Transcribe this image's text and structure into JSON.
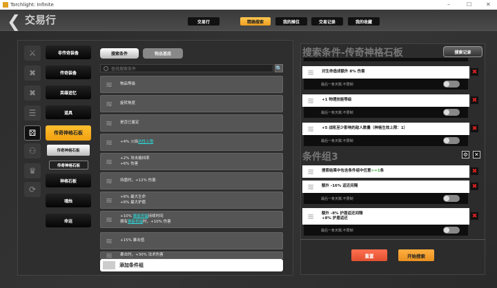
{
  "window": {
    "title": "Torchlight: Infinite",
    "minimize": "–",
    "maximize": "☐",
    "close": "✕"
  },
  "header": {
    "back": "❮",
    "title": "交易行",
    "tabs": [
      "交易行",
      "精确搜索",
      "我的摊位",
      "交易记录",
      "我的收藏"
    ],
    "active_tab": 1
  },
  "categories": [
    "非传奇装备",
    "传奇装备",
    "英雄追忆",
    "道具",
    "传奇神格石板",
    "神格石板",
    "魂烛",
    "命运"
  ],
  "subcategories": [
    "传奇神格石板",
    "传奇神格石板"
  ],
  "middle": {
    "tabs": [
      "搜索条件",
      "物品基底"
    ],
    "search_placeholder": "查找搜索条件",
    "search_icon": "🔍",
    "conditions": [
      {
        "parts": [
          {
            "t": "物品等级"
          }
        ]
      },
      {
        "parts": [
          {
            "t": "旋转角度"
          }
        ]
      },
      {
        "parts": [
          {
            "t": "是否已鉴定"
          }
        ]
      },
      {
        "parts": [
          {
            "t": "+4% 火焰"
          },
          {
            "t": "抗性上限",
            "hl": true
          }
        ]
      },
      {
        "lines": [
          "+2% 攻击格挡率",
          "+6% 伤害"
        ]
      },
      {
        "parts": [
          {
            "t": "持盾时，+12% 伤害"
          }
        ]
      },
      {
        "lines": [
          "+6% 最大生命",
          "+6% 最大护盾"
        ]
      },
      {
        "rich": [
          [
            {
              "t": "+10% "
            },
            {
              "t": "聚能祝福",
              "hl": true
            },
            {
              "t": "持续时间"
            }
          ],
          [
            {
              "t": "拥有"
            },
            {
              "t": "聚能祝福",
              "hl": true
            },
            {
              "t": "时，+10% 伤害"
            }
          ]
        ]
      },
      {
        "parts": [
          {
            "t": "+15% 暴击值"
          }
        ]
      },
      {
        "parts": [
          {
            "t": "暴击时，+30% 法术伤害"
          }
        ]
      }
    ],
    "add_group": "添加条件组"
  },
  "right": {
    "title": "搜索条件-传奇神格石板",
    "record_btn": "搜索记录",
    "group1": [
      {
        "text": "对生命造成额外 8% 伤害",
        "opt": "最后一条天赋:不限制"
      },
      {
        "text": "+1 物理技能等级",
        "opt": "最后一条天赋:不限制"
      },
      {
        "text": "+5 战吼至少影响的敌人数量（神格生效上限：1）",
        "opt": "最后一条天赋:不限制"
      }
    ],
    "group3_title": "条件组3",
    "group3_summary": {
      "pre": "搜索结果中包含条件组中任意",
      "hl": ">=1",
      "post": "条"
    },
    "group3": [
      {
        "lines": [
          "额外 -16% 返还间隔"
        ],
        "opt": "最后一条天赋:不限制"
      },
      {
        "lines": [
          "额外 -8% 护盾返还间隔",
          "+8% 护盾返还"
        ],
        "opt": "最后一条天赋:不限制"
      }
    ],
    "reset": "重置",
    "start": "开始搜索"
  }
}
